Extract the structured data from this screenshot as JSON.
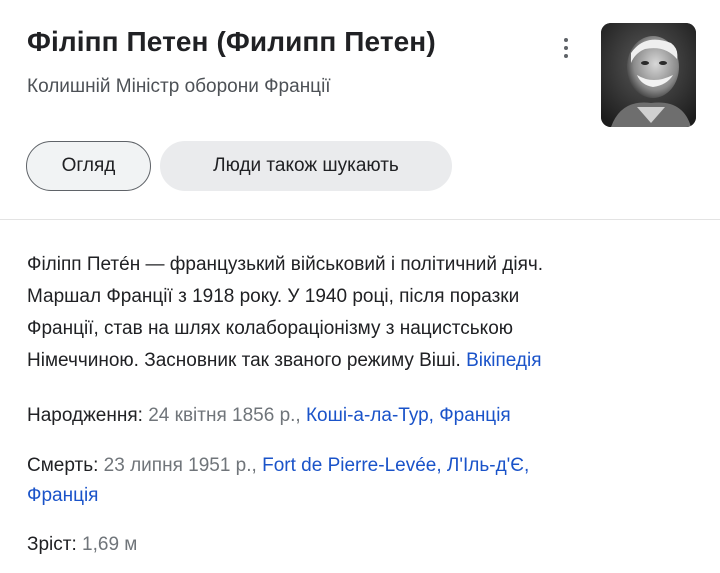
{
  "header": {
    "title": "Філіпп Петен (Филипп Петен)",
    "subtitle": "Колишній Міністр оборони Франції"
  },
  "tabs": [
    {
      "label": "Огляд",
      "selected": true
    },
    {
      "label": "Люди також шукають",
      "selected": false
    }
  ],
  "description": {
    "lines": [
      "Філіпп Петéн — французький військовий і політичний діяч.",
      "Маршал Франції з 1918 року. У 1940 році, після поразки",
      "Франції, став на шлях колабораціонізму з нацистською",
      "Німеччиною. Засновник так званого режиму Віші."
    ],
    "source_link": "Вікіпедія"
  },
  "facts": {
    "born": {
      "label": "Народження",
      "value": "24 квітня 1856 р.,",
      "place_link": "Коші-а-ла-Тур, Франція"
    },
    "death": {
      "label": "Смерть",
      "value": "23 липня 1951 р.,",
      "place_link_line1": "Fort de Pierre-Levée, Л'Іль-д'Є,",
      "place_link_line2": "Франція"
    },
    "height": {
      "label": "Зріст",
      "value": "1,69 м"
    }
  },
  "colors": {
    "link": "#1a53c9",
    "muted": "#70757a",
    "text": "#202124"
  },
  "icons": {
    "more": "more-vert-icon"
  }
}
